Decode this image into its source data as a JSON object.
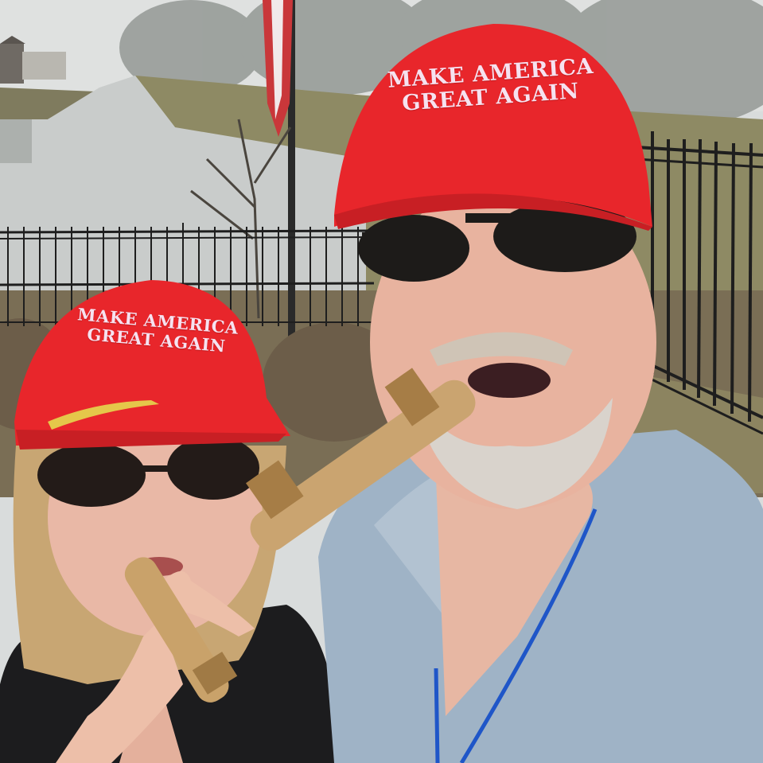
{
  "caps": {
    "left": {
      "line1": "MAKE AMERICA",
      "line2": "GREAT AGAIN"
    },
    "right": {
      "line1": "MAKE AMERICA",
      "line2": "GREAT AGAIN"
    }
  },
  "colors": {
    "sky": "#dfe1e0",
    "water": "#c9cccb",
    "grass": "#8e8a64",
    "fence": "#1e1e1e",
    "cap_red": "#e8262b",
    "cap_text": "#f6e2f0",
    "shirt": "#9fb3c6",
    "lanyard": "#1f56c8",
    "cigar": "#c9a26a"
  }
}
